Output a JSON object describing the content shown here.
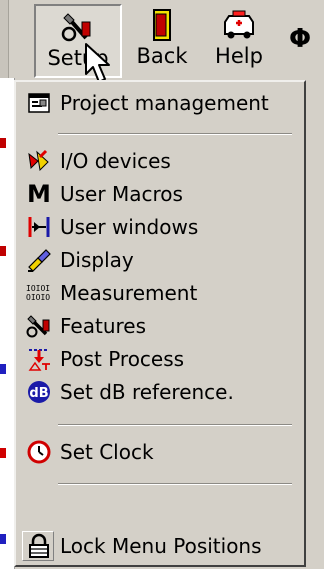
{
  "toolbar": {
    "buttons": [
      {
        "label": "Setup",
        "icon": "setup-icon"
      },
      {
        "label": "Back",
        "icon": "back-icon"
      },
      {
        "label": "Help",
        "icon": "help-icon"
      },
      {
        "label": "Φ",
        "icon": "phi-glyph"
      }
    ]
  },
  "menu": {
    "items": [
      {
        "label": "Project management",
        "icon": "project-management-icon"
      },
      {
        "label": "I/O devices",
        "icon": "io-devices-icon"
      },
      {
        "label": "User Macros",
        "icon": "user-macros-icon",
        "glyph": "M"
      },
      {
        "label": "User windows",
        "icon": "user-windows-icon"
      },
      {
        "label": "Display",
        "icon": "display-icon"
      },
      {
        "label": "Measurement",
        "icon": "measurement-icon",
        "glyph": "IOIOI OIOIO"
      },
      {
        "label": "Features",
        "icon": "features-icon"
      },
      {
        "label": "Post Process",
        "icon": "post-process-icon"
      },
      {
        "label": "Set dB reference.",
        "icon": "set-db-reference-icon"
      },
      {
        "label": "Set Clock",
        "icon": "clock-icon"
      },
      {
        "label": "Lock Menu Positions",
        "icon": "lock-icon"
      }
    ]
  },
  "colors": {
    "face": "#d4d0c8",
    "accent_red": "#d40000",
    "accent_blue": "#1a1aa8",
    "accent_yellow": "#f2d200"
  }
}
